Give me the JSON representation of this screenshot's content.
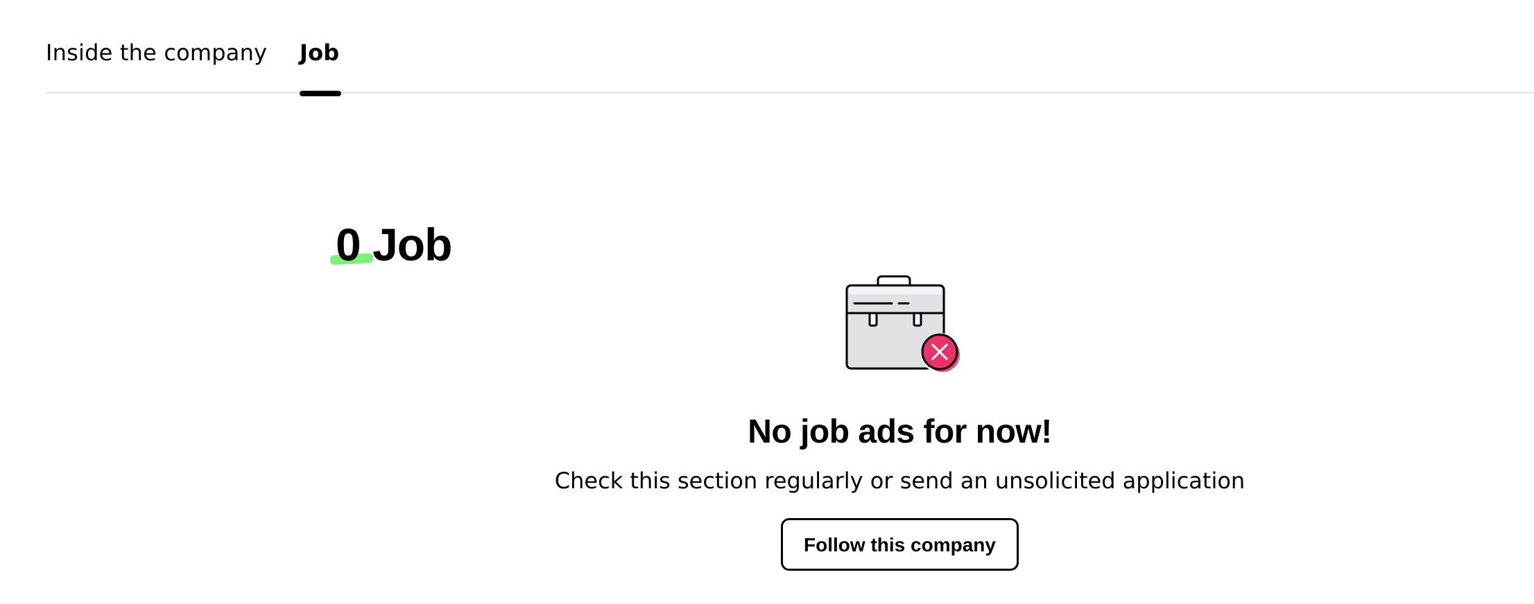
{
  "tabs": [
    {
      "label": "Inside the company",
      "active": false
    },
    {
      "label": "Job",
      "active": true
    }
  ],
  "jobs": {
    "count": "0",
    "label": "Job"
  },
  "empty_state": {
    "icon": "briefcase-with-x-icon",
    "title": "No job ads for now!",
    "subtitle": "Check this section regularly or send an unsolicited application",
    "button_label": "Follow this company"
  },
  "colors": {
    "highlight": "#7ef07a",
    "error_badge": "#e8336a",
    "briefcase_fill": "#e2e1e6"
  }
}
